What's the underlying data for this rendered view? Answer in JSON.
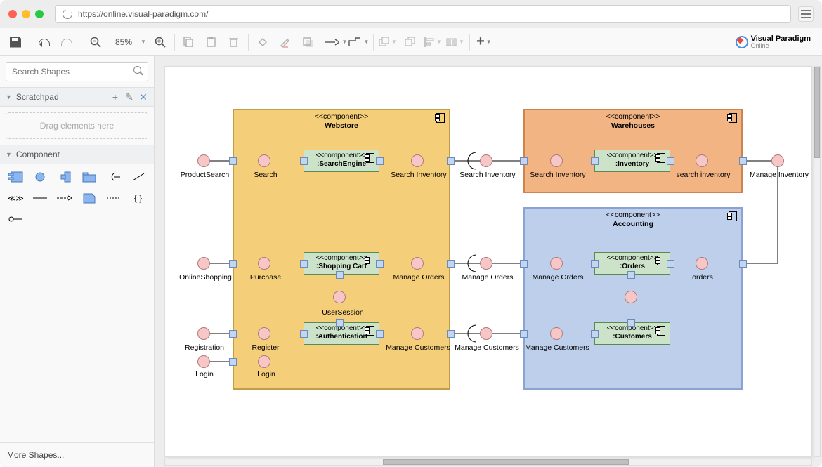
{
  "browser": {
    "url": "https://online.visual-paradigm.com/"
  },
  "brand": {
    "name": "Visual Paradigm",
    "sub": "Online"
  },
  "toolbar": {
    "zoom": "85%"
  },
  "sidebar": {
    "searchPlaceholder": "Search Shapes",
    "scratchpad": {
      "title": "Scratchpad",
      "hint": "Drag elements here"
    },
    "componentPanel": {
      "title": "Component"
    },
    "moreShapes": "More Shapes..."
  },
  "diagram": {
    "containers": {
      "webstore": {
        "stereo": "<<component>>",
        "name": "Webstore"
      },
      "warehouses": {
        "stereo": "<<component>>",
        "name": "Warehouses"
      },
      "accounting": {
        "stereo": "<<component>>",
        "name": "Accounting"
      }
    },
    "components": {
      "searchEngine": {
        "stereo": "<<component>>",
        "name": ":SearchEngine"
      },
      "shoppingCart": {
        "stereo": "<<component>>",
        "name": ":Shopping Cart"
      },
      "authentication": {
        "stereo": "<<component>>",
        "name": ":Authentication"
      },
      "inventory": {
        "stereo": "<<component>>",
        "name": ":Inventory"
      },
      "orders": {
        "stereo": "<<component>>",
        "name": ":Orders"
      },
      "customers": {
        "stereo": "<<component>>",
        "name": ":Customers"
      }
    },
    "labels": {
      "productSearch": "ProductSearch",
      "search": "Search",
      "searchInventory1": "Search Inventory",
      "searchInventory2": "Search Inventory",
      "searchInventory3": "Search Inventory",
      "searchInventoryLc": "search inventory",
      "manageInventory": "Manage Inventory",
      "onlineShopping": "OnlineShopping",
      "purchase": "Purchase",
      "manageOrders1": "Manage Orders",
      "manageOrders2": "Manage Orders",
      "manageOrders3": "Manage Orders",
      "ordersLbl": "orders",
      "registration": "Registration",
      "register": "Register",
      "userSession": "UserSession",
      "manageCustomers1": "Manage Customers",
      "manageCustomers2": "Manage Customers",
      "manageCustomers3": "Manage Customers",
      "login": "Login",
      "login2": "Login"
    }
  }
}
